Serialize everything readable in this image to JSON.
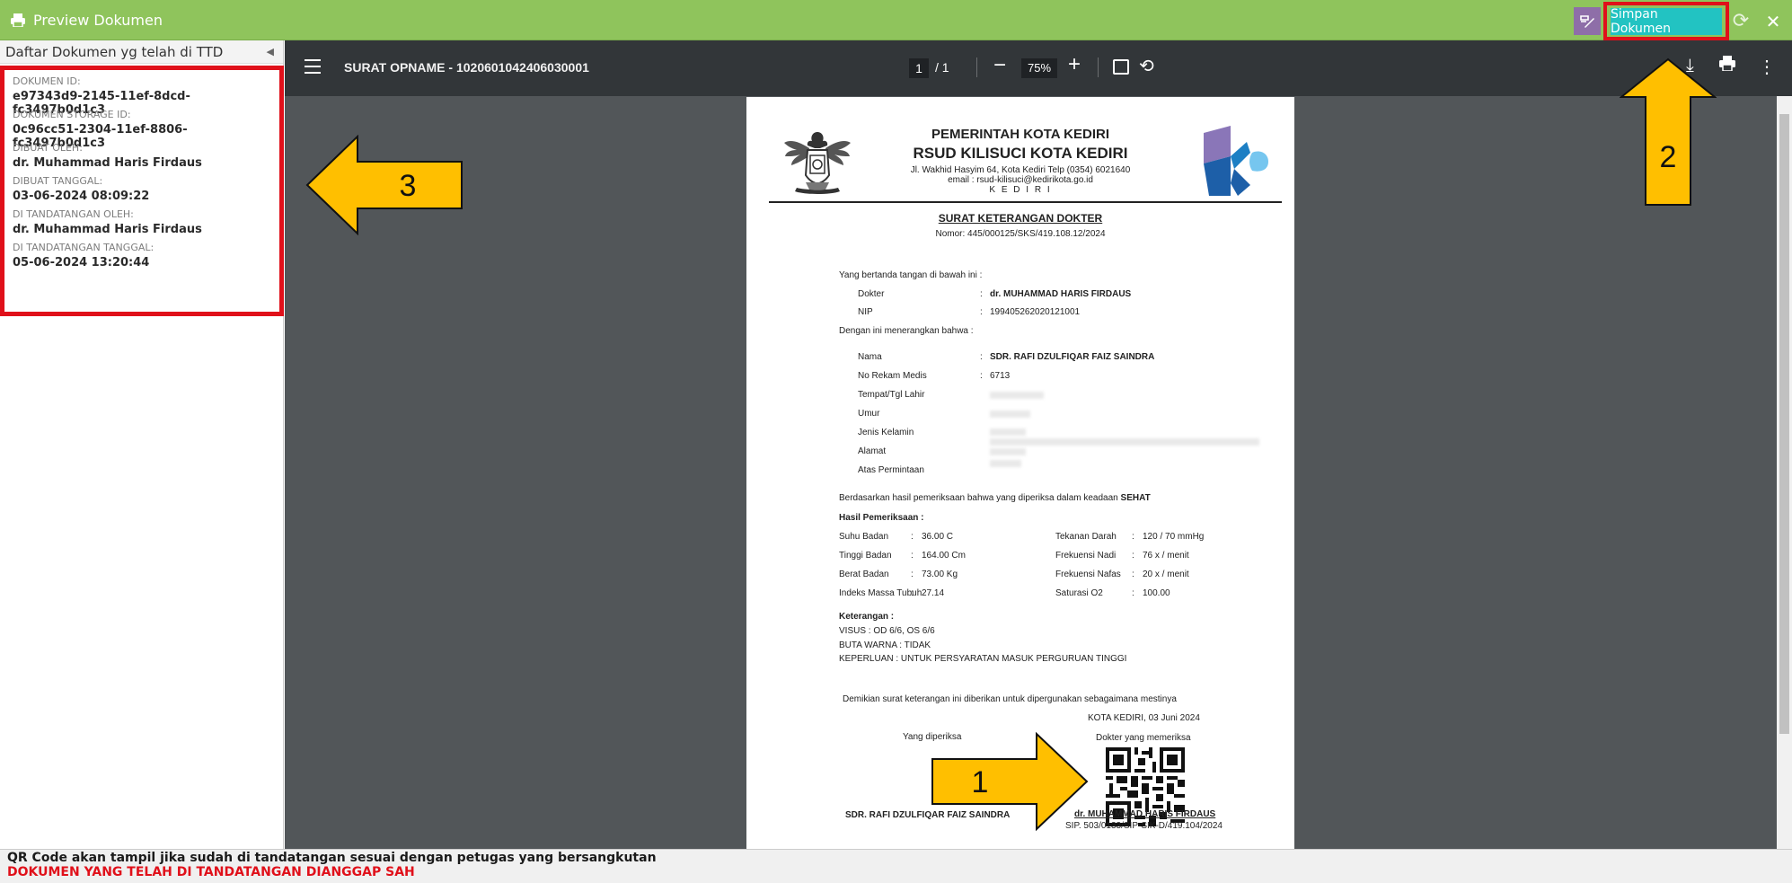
{
  "app": {
    "title": "Preview Dokumen",
    "save_label": "Simpan Dokumen"
  },
  "sidebar": {
    "header": "Daftar Dokumen yg telah di TTD",
    "fields": [
      {
        "label": "DOKUMEN ID:",
        "value": "e97343d9-2145-11ef-8dcd-fc3497b0d1c3"
      },
      {
        "label": "DOKUMEN STORAGE ID:",
        "value": "0c96cc51-2304-11ef-8806-fc3497b0d1c3"
      },
      {
        "label": "DIBUAT OLEH:",
        "value": "dr. Muhammad Haris Firdaus"
      },
      {
        "label": "DIBUAT TANGGAL:",
        "value": "03-06-2024 08:09:22"
      },
      {
        "label": "DI TANDATANGAN OLEH:",
        "value": "dr. Muhammad Haris Firdaus"
      },
      {
        "label": "DI TANDATANGAN TANGGAL:",
        "value": "05-06-2024 13:20:44"
      }
    ]
  },
  "viewer": {
    "doc_title": "SURAT OPNAME - 1020601042406030001",
    "page_current": "1",
    "page_total": "/  1",
    "zoom": "75%"
  },
  "document": {
    "gov": "PEMERINTAH KOTA KEDIRI",
    "hospital": "RSUD KILISUCI KOTA KEDIRI",
    "address1": "Jl. Wakhid Hasyim 64, Kota Kediri Telp (0354) 6021640",
    "address2": "email : rsud-kilisuci@kedirikota.go.id",
    "address3": "K E D I R I",
    "heading": "SURAT KETERANGAN DOKTER",
    "number": "Nomor: 445/000125/SKS/419.108.12/2024",
    "intro": "Yang bertanda tangan di bawah ini  :",
    "doctor_label": "Dokter",
    "doctor_value": "dr. MUHAMMAD HARIS FIRDAUS",
    "nip_label": "NIP",
    "nip_value": "199405262020121001",
    "declare": "Dengan ini menerangkan bahwa :",
    "patient": [
      {
        "label": "Nama",
        "value": "SDR. RAFI DZULFIQAR FAIZ SAINDRA"
      },
      {
        "label": "No Rekam Medis",
        "value": "6713"
      },
      {
        "label": "Tempat/Tgl Lahir",
        "value": ""
      },
      {
        "label": "Umur",
        "value": ""
      },
      {
        "label": "Jenis Kelamin",
        "value": ""
      },
      {
        "label": "Alamat",
        "value": ""
      },
      {
        "label": "Atas Permintaan",
        "value": ""
      }
    ],
    "result_sentence": "Berdasarkan hasil pemeriksaan bahwa yang diperiksa dalam keadaan",
    "result_status": "SEHAT",
    "exam_heading": "Hasil Pemeriksaan :",
    "exam_left": [
      {
        "label": "Suhu Badan",
        "value": "36.00  C"
      },
      {
        "label": "Tinggi Badan",
        "value": "164.00 Cm"
      },
      {
        "label": "Berat Badan",
        "value": "73.00 Kg"
      },
      {
        "label": "Indeks Massa Tubuh",
        "value": "27.14"
      }
    ],
    "exam_right": [
      {
        "label": "Tekanan Darah",
        "value": "120 / 70 mmHg"
      },
      {
        "label": "Frekuensi Nadi",
        "value": "76  x / menit"
      },
      {
        "label": "Frekuensi Nafas",
        "value": "20  x / menit"
      },
      {
        "label": "Saturasi O2",
        "value": "100.00"
      }
    ],
    "notes_heading": "Keterangan :",
    "notes": [
      "VISUS : OD 6/6, OS 6/6",
      "BUTA WARNA : TIDAK",
      "KEPERLUAN : UNTUK PERSYARATAN MASUK PERGURUAN TINGGI"
    ],
    "closing": "Demikian surat keterangan ini diberikan untuk dipergunakan sebagaimana mestinya",
    "place_date": "KOTA KEDIRI, 03 Juni 2024",
    "examined_label": "Yang diperiksa",
    "examiner_label": "Dokter yang memeriksa",
    "examined_name": "SDR. RAFI DZULFIQAR FAIZ SAINDRA",
    "examiner_name": "dr. MUHAMMAD HARIS FIRDAUS",
    "examiner_sip": "SIP. 503/0133/SIP-SIK-D/419.104/2024"
  },
  "annotations": {
    "arrow1": "1",
    "arrow2": "2",
    "arrow3": "3"
  },
  "footer": {
    "note": "QR Code akan tampil jika sudah di tandatangan sesuai dengan petugas yang bersangkutan",
    "warning": "DOKUMEN YANG TELAH DI TANDATANGAN DIANGGAP SAH"
  },
  "colors": {
    "titlebar": "#8fc45c",
    "save_button": "#22c3c2",
    "highlight_border": "#e0101a",
    "arrow_fill": "#ffbf00"
  }
}
